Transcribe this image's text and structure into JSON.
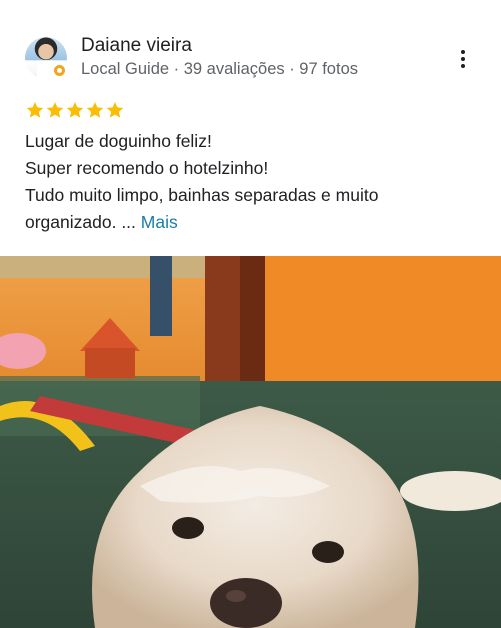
{
  "reviewer": {
    "name": "Daiane vieira",
    "meta": "Local Guide · 39 avaliações · 97 fotos",
    "avatar_icon": "user-avatar",
    "badge_icon": "local-guide-badge-icon",
    "badge_color": "#f4a41c"
  },
  "menu": {
    "icon": "more-vertical-icon"
  },
  "rating": {
    "stars": 5,
    "max": 5,
    "color": "#fbbc04"
  },
  "review": {
    "lines": [
      "Lugar de doguinho feliz!",
      "Super recomendo o hotelzinho!",
      "Tudo muito limpo, bainhas separadas e muito",
      "organizado. ..."
    ],
    "more_label": "Mais",
    "more_color": "#1a7ea8"
  },
  "photo": {
    "subject": "dog-photo"
  }
}
